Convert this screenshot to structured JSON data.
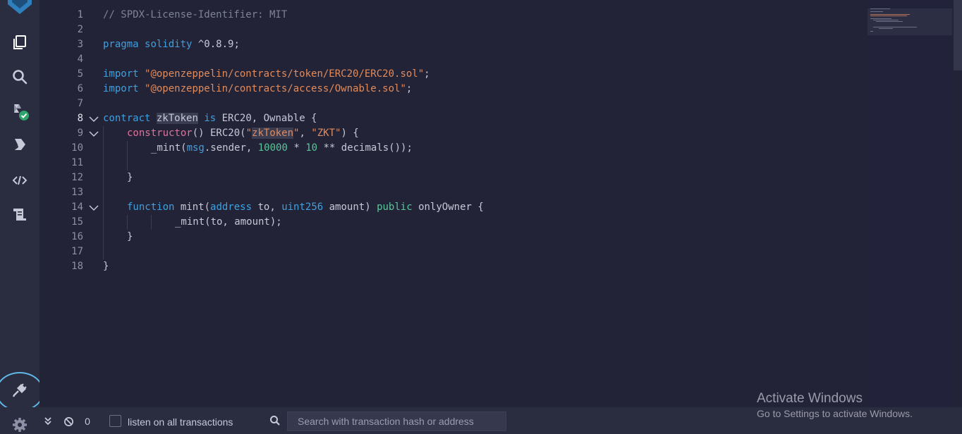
{
  "sidebar": {
    "icons": [
      "remix-logo-icon",
      "file-explorer-icon",
      "search-icon",
      "solidity-compiler-icon",
      "deploy-run-icon",
      "debugger-icon",
      "file-manager-icon",
      "plugin-manager-icon",
      "settings-icon"
    ]
  },
  "editor": {
    "line_numbers": [
      "1",
      "2",
      "3",
      "4",
      "5",
      "6",
      "7",
      "8",
      "9",
      "10",
      "11",
      "12",
      "13",
      "14",
      "15",
      "16",
      "17",
      "18"
    ],
    "lines": {
      "l1": "// SPDX-License-Identifier: MIT",
      "l3_kw": "pragma",
      "l3_kw2": "solidity",
      "l3_rest": " ^0.8.9;",
      "l5_kw": "import",
      "l5_str": "\"@openzeppelin/contracts/token/ERC20/ERC20.sol\"",
      "l5_end": ";",
      "l6_kw": "import",
      "l6_str": "\"@openzeppelin/contracts/access/Ownable.sol\"",
      "l6_end": ";",
      "l8_kw": "contract",
      "l8_name": "zkToken",
      "l8_is": "is",
      "l8_rest": " ERC20, Ownable {",
      "l9_fn": "constructor",
      "l9_a": "() ERC20(",
      "l9_q1": "\"",
      "l9_hl": "zkToken",
      "l9_q2": "\"",
      "l9_b": ", ",
      "l9_str2": "\"ZKT\"",
      "l9_c": ") {",
      "l10_a": "_mint(",
      "l10_msg": "msg",
      "l10_b": ".sender, ",
      "l10_num1": "10000",
      "l10_c": " * ",
      "l10_num2": "10",
      "l10_d": " ** decimals());",
      "l12": "}",
      "l14_fn": "function",
      "l14_a": " mint(",
      "l14_t1": "address",
      "l14_b": " to, ",
      "l14_t2": "uint256",
      "l14_c": " amount) ",
      "l14_pub": "public",
      "l14_d": " onlyOwner {",
      "l15": "_mint(to, amount);",
      "l16": "}",
      "l18": "}"
    }
  },
  "terminal": {
    "count": "0",
    "listen_label": "listen on all transactions",
    "search_placeholder": "Search with transaction hash or address"
  },
  "watermark": {
    "title": "Activate Windows",
    "subtitle": "Go to Settings to activate Windows."
  },
  "colors": {
    "background": "#222336",
    "sidebar": "#2a2c3f",
    "keyword": "#3fa0e0",
    "string": "#e28b5c",
    "function_kw": "#e2729a",
    "number": "#59c59a",
    "highlight_circle": "#5fb7e8"
  }
}
